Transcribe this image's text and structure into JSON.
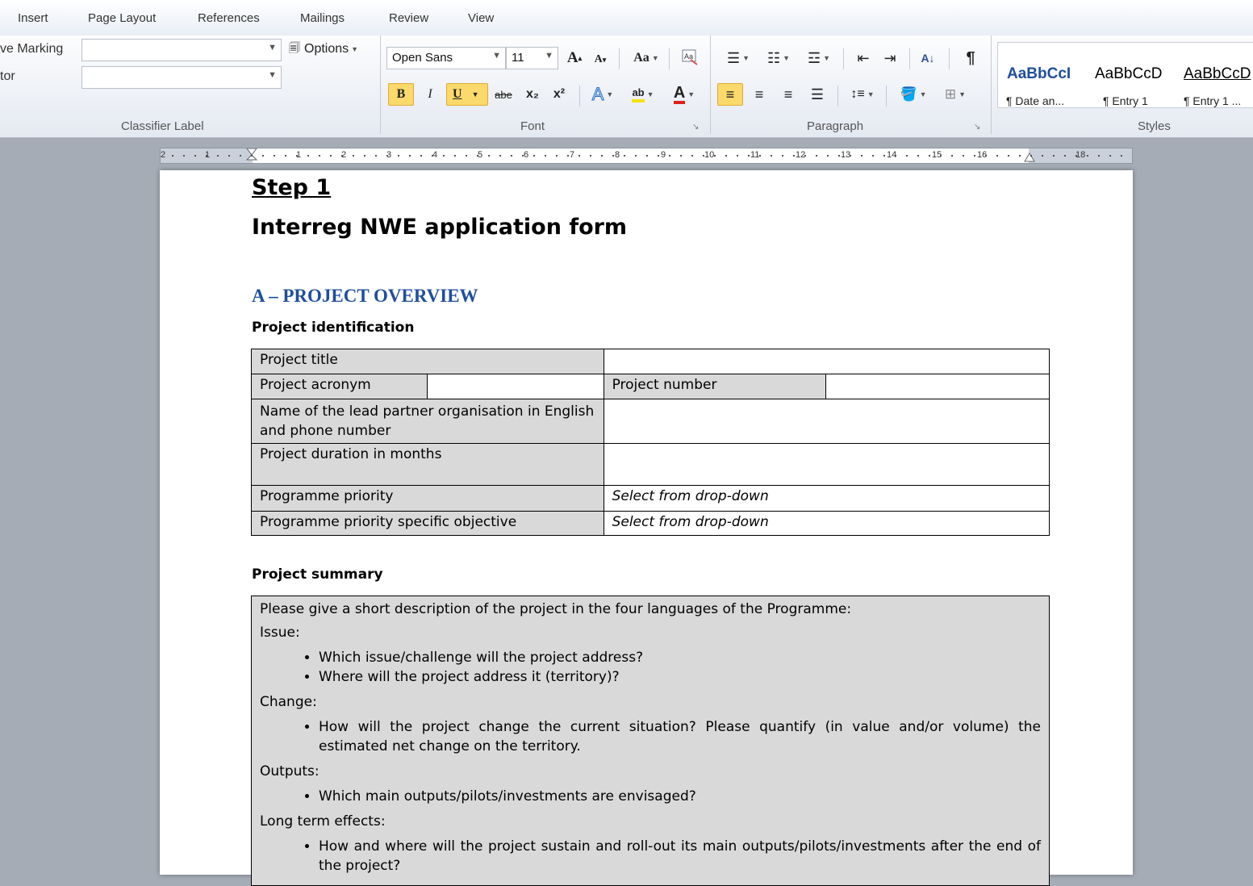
{
  "ribbon_tabs": [
    "Insert",
    "Page Layout",
    "References",
    "Mailings",
    "Review",
    "View"
  ],
  "classifier": {
    "row1_label": "ve Marking",
    "row2_label": "tor",
    "row1_value": "",
    "row2_value": "",
    "options_label": "Options",
    "group_label": "Classifier Label"
  },
  "font": {
    "family": "Open Sans",
    "size": "11",
    "grow_label": "A",
    "shrink_label": "A",
    "case_label": "Aa",
    "bold_label": "B",
    "italic_label": "I",
    "underline_label": "U",
    "strike_label": "abe",
    "subscript_label": "x₂",
    "superscript_label": "x²",
    "highlight_label": "ab",
    "color_label": "A",
    "group_label": "Font"
  },
  "paragraph": {
    "group_label": "Paragraph",
    "pilcrow": "¶"
  },
  "styles": {
    "group_label": "Styles",
    "items": [
      {
        "sample": "AaBbCcI",
        "name": "¶ Date an..."
      },
      {
        "sample": "AaBbCcD",
        "name": "¶ Entry 1"
      },
      {
        "sample": "AaBbCcD",
        "name": "¶ Entry 1 ..."
      }
    ]
  },
  "ruler": {
    "numbers": [
      "2",
      "1",
      "1",
      "2",
      "3",
      "4",
      "5",
      "6",
      "7",
      "8",
      "9",
      "10",
      "11",
      "12",
      "13",
      "14",
      "15",
      "16",
      "18"
    ]
  },
  "document": {
    "step_title": "Step 1",
    "form_title": "Interreg NWE application form",
    "section_heading": "A – PROJECT OVERVIEW",
    "identification_heading": "Project identification",
    "table": {
      "project_title_label": "Project title",
      "project_title_value": "",
      "acronym_label": "Project acronym",
      "acronym_value": "",
      "number_label": "Project number",
      "number_value": "",
      "lead_partner_label": "Name of the lead partner organisation in English and phone number",
      "lead_partner_value": "",
      "duration_label": "Project duration in months",
      "duration_value": "",
      "priority_label": "Programme priority",
      "priority_value": "Select from drop-down",
      "objective_label": "Programme priority specific objective",
      "objective_value": "Select from drop-down"
    },
    "summary_heading": "Project summary",
    "summary": {
      "intro": "Please give a short description of the project in the four languages of the Programme:",
      "issue_label": "Issue:",
      "issue_items": [
        "Which issue/challenge will the project address?",
        "Where will the project address it (territory)?"
      ],
      "change_label": "Change:",
      "change_items": [
        "How will the project change the current situation? Please quantify (in value and/or volume) the estimated net change on the territory."
      ],
      "outputs_label": "Outputs:",
      "outputs_items": [
        "Which main outputs/pilots/investments are envisaged?"
      ],
      "effects_label": "Long term effects:",
      "effects_items": [
        "How and where will the project sustain and roll-out its main outputs/pilots/investments after the end of the project?"
      ]
    }
  },
  "colors": {
    "heading_blue": "#1f4e9c",
    "highlight_button": "#fbd96b",
    "font_color_red": "#e0201b",
    "table_grey": "#d9d9d9"
  }
}
